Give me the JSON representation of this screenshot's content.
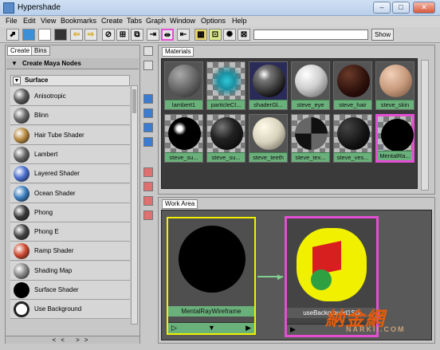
{
  "window": {
    "title": "Hypershade",
    "controls": [
      "–",
      "□",
      "✕"
    ]
  },
  "menubar": [
    "File",
    "Edit",
    "View",
    "Bookmarks",
    "Create",
    "Tabs",
    "Graph",
    "Window",
    "Options",
    "Help"
  ],
  "toolbar": {
    "show_label": "Show",
    "search_value": ""
  },
  "left_panel": {
    "tabs": [
      "Create",
      "Bins"
    ],
    "header": "Create Maya Nodes",
    "section": "Surface",
    "nodes": [
      {
        "label": "Anisotropic",
        "swatch": "#5a5a5a"
      },
      {
        "label": "Blinn",
        "swatch": "#6a6a6a"
      },
      {
        "label": "Hair Tube Shader",
        "swatch": "#b88a40"
      },
      {
        "label": "Lambert",
        "swatch": "#666666"
      },
      {
        "label": "Layered Shader",
        "swatch": "#4b6fd0"
      },
      {
        "label": "Ocean Shader",
        "swatch": "#3c7fbf"
      },
      {
        "label": "Phong",
        "swatch": "#3a3a3a"
      },
      {
        "label": "Phong E",
        "swatch": "#444444"
      },
      {
        "label": "Ramp Shader",
        "swatch": "#d04a30"
      },
      {
        "label": "Shading Map",
        "swatch": "#8a8a8a"
      },
      {
        "label": "Surface Shader",
        "swatch": "#000000"
      },
      {
        "label": "Use Background",
        "swatch": "#ffffff"
      }
    ],
    "bottom_tabs": "<< >>"
  },
  "materials": {
    "tab": "Materials",
    "items": [
      {
        "label": "lambert1",
        "style": "grey",
        "selected": false
      },
      {
        "label": "particleCl...",
        "style": "cyan",
        "selected": false
      },
      {
        "label": "shaderGl...",
        "style": "gloss",
        "selected": false
      },
      {
        "label": "steve_eye",
        "style": "light",
        "selected": false
      },
      {
        "label": "steve_hair",
        "style": "darkred",
        "selected": false
      },
      {
        "label": "steve_skin",
        "style": "skin",
        "selected": false
      },
      {
        "label": "steve_su...",
        "style": "blackspot",
        "selected": false
      },
      {
        "label": "steve_su...",
        "style": "black",
        "selected": false
      },
      {
        "label": "steve_teeth",
        "style": "teeth",
        "selected": false
      },
      {
        "label": "steve_tex...",
        "style": "texture",
        "selected": false
      },
      {
        "label": "steve_ves...",
        "style": "vest",
        "selected": false
      },
      {
        "label": "MentalRa...",
        "style": "mental",
        "selected": true
      }
    ]
  },
  "work_area": {
    "tab": "Work Area",
    "nodes": [
      {
        "label": "MentalRayWireframe"
      },
      {
        "label": "useBackground1SG"
      }
    ]
  },
  "watermark": {
    "main": "納金網",
    "sub": "NARKII.COM"
  },
  "colors": {
    "highlight": "#e34fd2",
    "node_bar": "#6ab07b",
    "selection": "#f0f000"
  }
}
